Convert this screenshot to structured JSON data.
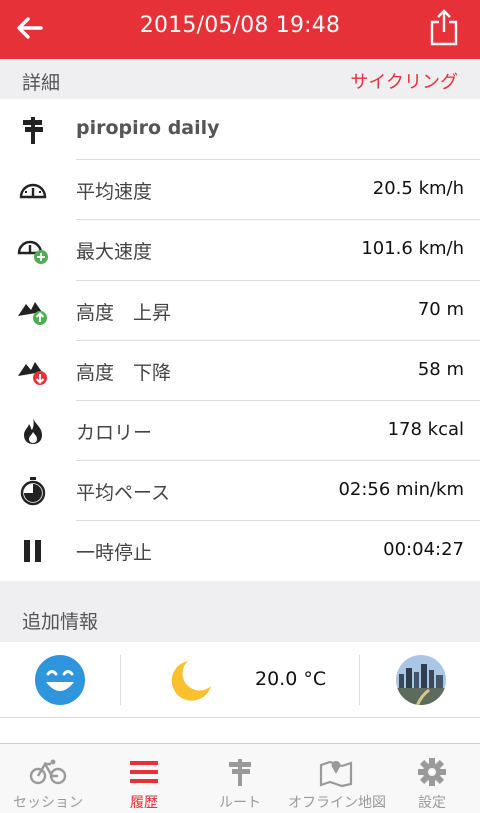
{
  "header": {
    "title": "2015/05/08 19:48",
    "back_icon": "arrow-left-icon",
    "share_icon": "share-icon",
    "background": "#e53137"
  },
  "details": {
    "section_label": "詳細",
    "activity_type": "サイクリング",
    "rows": [
      {
        "icon": "signpost-icon",
        "label": "piropiro daily",
        "value": ""
      },
      {
        "icon": "speedometer-icon",
        "label": "平均速度",
        "value": "20.5 km/h"
      },
      {
        "icon": "speedometer-plus-icon",
        "label": "最大速度",
        "value": "101.6 km/h"
      },
      {
        "icon": "mountain-up-icon",
        "label": "高度　上昇",
        "value": "70 m"
      },
      {
        "icon": "mountain-down-icon",
        "label": "高度　下降",
        "value": "58 m"
      },
      {
        "icon": "flame-icon",
        "label": "カロリー",
        "value": "178 kcal"
      },
      {
        "icon": "stopwatch-icon",
        "label": "平均ペース",
        "value": "02:56 min/km"
      },
      {
        "icon": "pause-icon",
        "label": "一時停止",
        "value": "00:04:27"
      }
    ]
  },
  "extra": {
    "section_label": "追加情報",
    "mood_icon": "smiley-face-icon",
    "weather_icon": "moon-icon",
    "temperature": "20.0 °C",
    "photo_icon": "road-photo-icon"
  },
  "tabbar": {
    "tabs": [
      {
        "label": "セッション",
        "icon": "bicycle-icon",
        "active": false
      },
      {
        "label": "履歴",
        "icon": "list-icon",
        "active": true
      },
      {
        "label": "ルート",
        "icon": "signpost-icon",
        "active": false
      },
      {
        "label": "オフライン地図",
        "icon": "map-icon",
        "active": false
      },
      {
        "label": "設定",
        "icon": "gear-icon",
        "active": false
      }
    ]
  }
}
